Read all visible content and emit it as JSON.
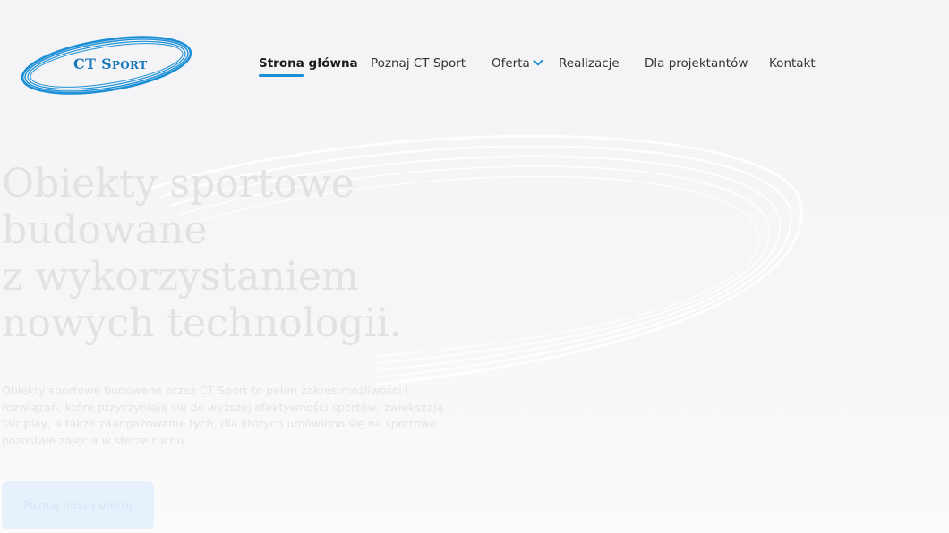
{
  "brand": {
    "name_main": "CT S",
    "name_smallcaps": "port",
    "color": "#1b8fd6"
  },
  "nav": {
    "items": [
      {
        "label": "Strona główna",
        "active": true
      },
      {
        "label": "Poznaj CT Sport",
        "active": false
      },
      {
        "label": "Oferta",
        "active": false,
        "has_dropdown": true
      },
      {
        "label": "Realizacje",
        "active": false
      },
      {
        "label": "Dla projektantów",
        "active": false
      },
      {
        "label": "Kontakt",
        "active": false
      }
    ]
  },
  "hero": {
    "title_lines": [
      "Obiekty sportowe",
      "budowane",
      "z wykorzystaniem",
      "nowych technologii."
    ],
    "description_lines": [
      "Obiekty sportowe budowane przez CT Sport to pełen zakres możliwości i",
      "rozwiązań, które przyczyniają się do wyższej efektywności sportów, zwiększają",
      "fair play, a także zaangażowanie tych, dla których umówiono się na sportowe",
      "pozostałe zajęcia w sferze ruchu."
    ],
    "cta_label": "Poznaj naszą ofertę"
  },
  "icons": {
    "logo": "ct-sport-oval-logo-icon",
    "dropdown": "chevron-down-icon"
  }
}
